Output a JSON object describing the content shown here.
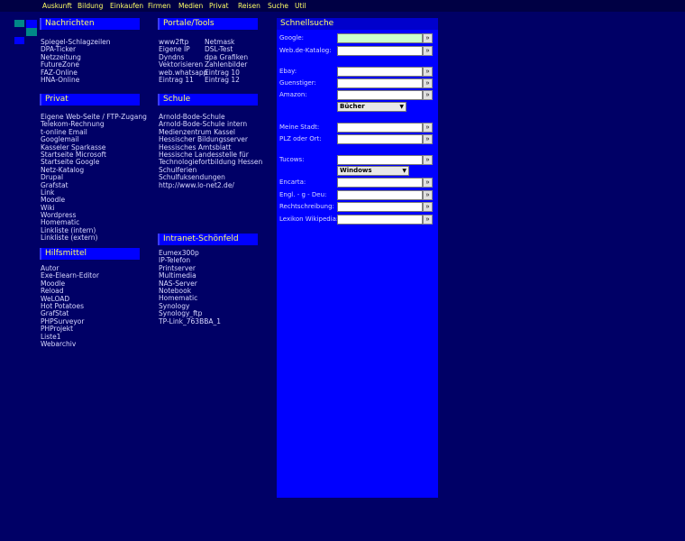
{
  "topnav": [
    "Auskunft",
    "Bildung",
    "Einkaufen",
    "Firmen",
    "Medien",
    "Privat",
    "Reisen",
    "Suche",
    "Util"
  ],
  "nachrichten": {
    "title": "Nachrichten",
    "items": [
      "Spiegel-Schlagzeilen",
      "DPA-Ticker",
      "Netzzeitung",
      "FutureZone",
      "FAZ-Online",
      "HNA-Online"
    ]
  },
  "portale": {
    "title": "Portale/Tools",
    "col1": [
      "www2ftp",
      "Eigene IP",
      "Dyndns",
      "Vektorisieren",
      "web.whatsapp",
      "Eintrag 11"
    ],
    "col2": [
      "Netmask",
      "DSL-Test",
      "dpa Grafiken",
      "Zahlenbilder",
      "Eintrag 10",
      "Eintrag 12"
    ]
  },
  "privat": {
    "title": "Privat",
    "items": [
      "Eigene Web-Seite / FTP-Zugang",
      "Telekom-Rechnung",
      "t-online Email",
      "Googlemail",
      "Kasseler Sparkasse",
      "Startseite Microsoft",
      "Startseite Google",
      "Netz-Katalog",
      "Drupal",
      "Grafstat",
      "Link",
      "Moodle",
      "Wiki",
      "Wordpress",
      "Homematic",
      "Linkliste (intern)",
      "Linkliste (extern)"
    ]
  },
  "schule": {
    "title": "Schule",
    "items": [
      "Arnold-Bode-Schule",
      "Arnold-Bode-Schule intern",
      "Medienzentrum Kassel",
      "Hessischer Bildungsserver",
      "Hessisches Amtsblatt",
      "Hessische Landesstelle für",
      "Technologiefortbildung Hessen",
      "Schulferien",
      "Schulfuksendungen",
      "http://www.lo-net2.de/"
    ]
  },
  "intranet": {
    "title": "Intranet-Schönfeld",
    "items": [
      "Eumex300p",
      "IP-Telefon",
      "Printserver",
      "Multimedia",
      "NAS-Server",
      "Notebook",
      "Homematic",
      "Synology",
      "Synology_ftp",
      "TP-Link_763BBA_1"
    ]
  },
  "hilfsmittel": {
    "title": "Hilfsmittel",
    "items": [
      "Autor",
      "Exe-Elearn-Editor",
      "Moodle",
      "Reload",
      "WeLOAD",
      "Hot Potatoes",
      "GrafStat",
      "PHPSurveyor",
      "PHProjekt",
      "Liste1",
      "Webarchiv"
    ]
  },
  "search": {
    "title": "Schnellsuche",
    "go": "»",
    "fields": [
      {
        "label": "Google:",
        "value": ""
      },
      {
        "label": "Web.de-Katalog:",
        "value": ""
      },
      {
        "label": "Ebay:",
        "value": ""
      },
      {
        "label": "Guenstiger:",
        "value": ""
      },
      {
        "label": "Amazon:",
        "value": ""
      },
      {
        "label": "Meine Stadt:",
        "value": ""
      },
      {
        "label": "PLZ oder Ort:",
        "value": ""
      },
      {
        "label": "Tucows:",
        "value": ""
      },
      {
        "label": "Encarta:",
        "value": ""
      },
      {
        "label": "Engl. - g - Deu:",
        "value": ""
      },
      {
        "label": "Rechtschreibung:",
        "value": ""
      },
      {
        "label": "Lexikon Wikipedia:",
        "value": ""
      }
    ],
    "amazon_select": "Bücher",
    "tucows_select": "Windows"
  },
  "colors": {
    "background": "#000066",
    "accent": "#0000ff",
    "heading_text": "#ffff66",
    "google_field": "#ccffcc"
  }
}
